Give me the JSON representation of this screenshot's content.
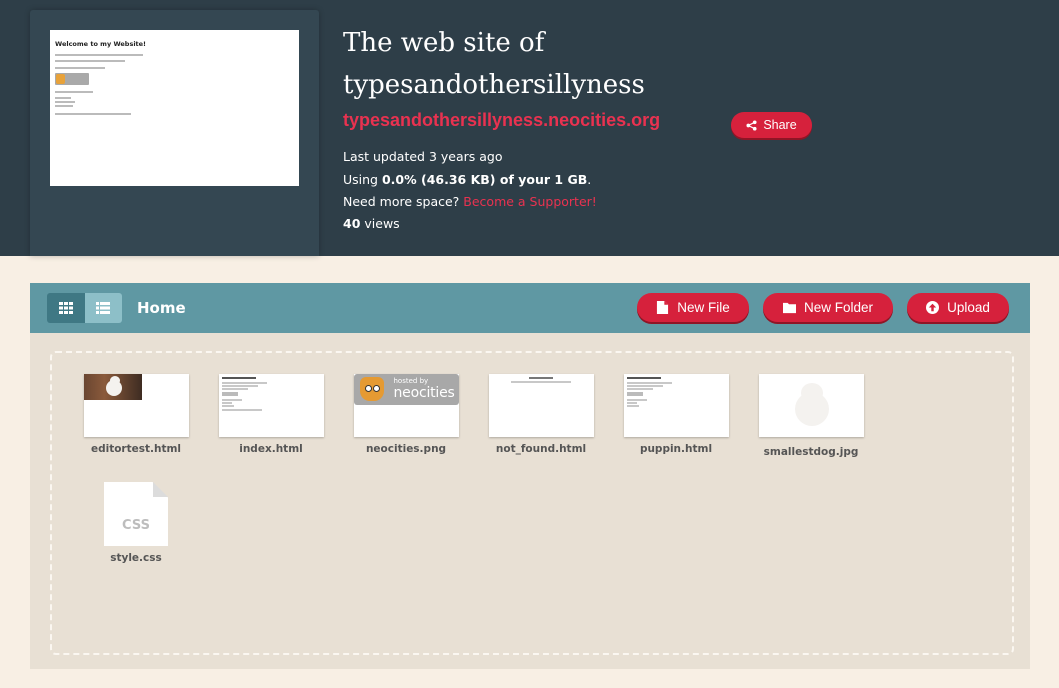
{
  "header": {
    "title": "The web site of typesandothersillyness",
    "url": "typesandothersillyness.neocities.org",
    "share_label": "Share",
    "last_updated": "Last updated 3 years ago",
    "usage_prefix": "Using ",
    "usage_value": "0.0% (46.36 KB) of your 1 GB",
    "usage_suffix": ".",
    "need_space": "Need more space? ",
    "supporter_link": "Become a Supporter!",
    "views_count": "40",
    "views_label": " views",
    "thumbnail": {
      "heading": "Welcome to my Website!"
    }
  },
  "toolbar": {
    "breadcrumb": "Home",
    "new_file_label": "New File",
    "new_folder_label": "New Folder",
    "upload_label": "Upload"
  },
  "neocities_badge": {
    "small": "hosted by",
    "big": "neocities"
  },
  "files": [
    {
      "name": "editortest.html"
    },
    {
      "name": "index.html"
    },
    {
      "name": "neocities.png"
    },
    {
      "name": "not_found.html"
    },
    {
      "name": "puppin.html"
    },
    {
      "name": "smallestdog.jpg"
    },
    {
      "name": "style.css",
      "icon_text": "CSS"
    }
  ],
  "colors": {
    "header_bg": "#2e3e48",
    "accent": "#e93250",
    "button_red": "#d6213c",
    "toolbar_teal": "#5f98a3"
  }
}
